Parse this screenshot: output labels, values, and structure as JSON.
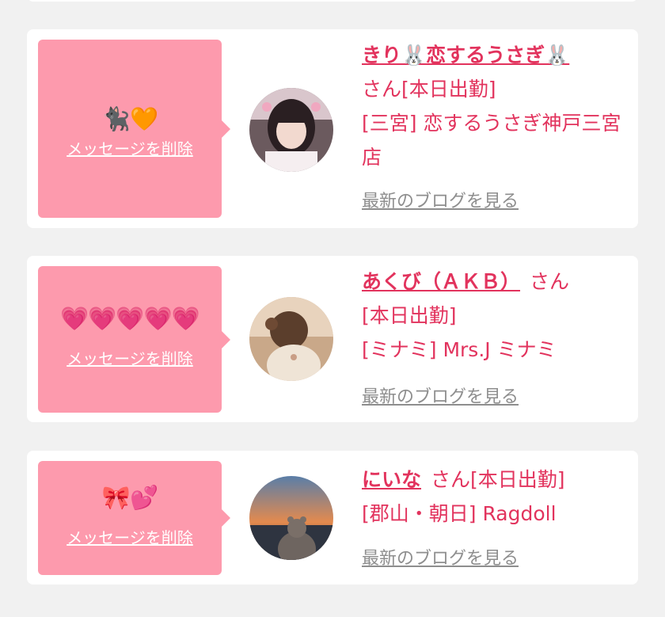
{
  "cards": [
    {
      "emojis": "🐈‍⬛🧡",
      "delete_label": "メッセージを削除",
      "name": "きり🐰恋するうさぎ🐰",
      "honorific": "さん",
      "status": "[本日出勤]",
      "shop": "[三宮] 恋するうさぎ神戸三宮店",
      "blog_label": "最新のブログを見る"
    },
    {
      "emojis": "💗💗💗💗💗",
      "delete_label": "メッセージを削除",
      "name": "あくび（ＡＫＢ）",
      "honorific": "さん",
      "status": "[本日出勤]",
      "shop": "[ミナミ] Mrs.J ミナミ",
      "blog_label": "最新のブログを見る"
    },
    {
      "emojis": "🎀💕",
      "delete_label": "メッセージを削除",
      "name": "にいな",
      "honorific": "さん",
      "status": "[本日出勤]",
      "shop": "[郡山・朝日] Ragdoll",
      "blog_label": "最新のブログを見る"
    }
  ],
  "colors": {
    "accent": "#e2335d",
    "bubble": "#fd9aad",
    "link_gray": "#8e8e8e",
    "background": "#f1f1f1"
  }
}
